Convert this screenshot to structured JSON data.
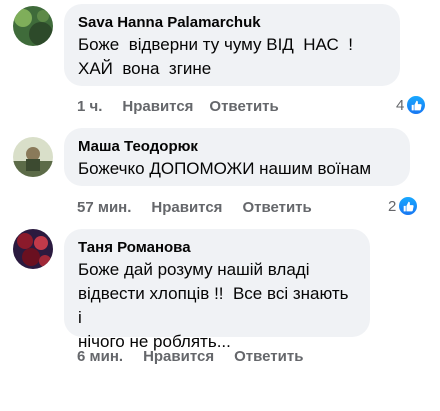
{
  "comments": [
    {
      "author": "Sava Hanna Palamarchuk",
      "text": "Боже  відверни ту чуму ВІД  НАС  !\nХАЙ  вона  згине",
      "time": "1 ч.",
      "like_label": "Нравится",
      "reply_label": "Ответить",
      "reaction_count": "4",
      "avatar_colors": [
        "#3f6b3a",
        "#7fae5a",
        "#2d4a2a"
      ]
    },
    {
      "author": "Маша Теодорюк",
      "text": "Божечко ДОПОМОЖИ нашим воїнам",
      "time": "57 мин.",
      "like_label": "Нравится",
      "reply_label": "Ответить",
      "reaction_count": "2",
      "avatar_colors": [
        "#b9c9a8",
        "#5c6b48",
        "#e6ead8"
      ]
    },
    {
      "author": "Таня Романова",
      "text": "Боже дай розуму нашій владі\nвідвести хлопців !!  Все всі знають і\nнічого не роблять...",
      "time": "6 мин.",
      "like_label": "Нравится",
      "reply_label": "Ответить",
      "avatar_colors": [
        "#8b1a2b",
        "#2b1a3f",
        "#c23a4a"
      ]
    }
  ],
  "colors": {
    "bubble": "#f0f2f5",
    "meta": "#65676b",
    "like_badge": "#1877f2"
  },
  "icons": {
    "reaction": "like-thumb-icon"
  }
}
